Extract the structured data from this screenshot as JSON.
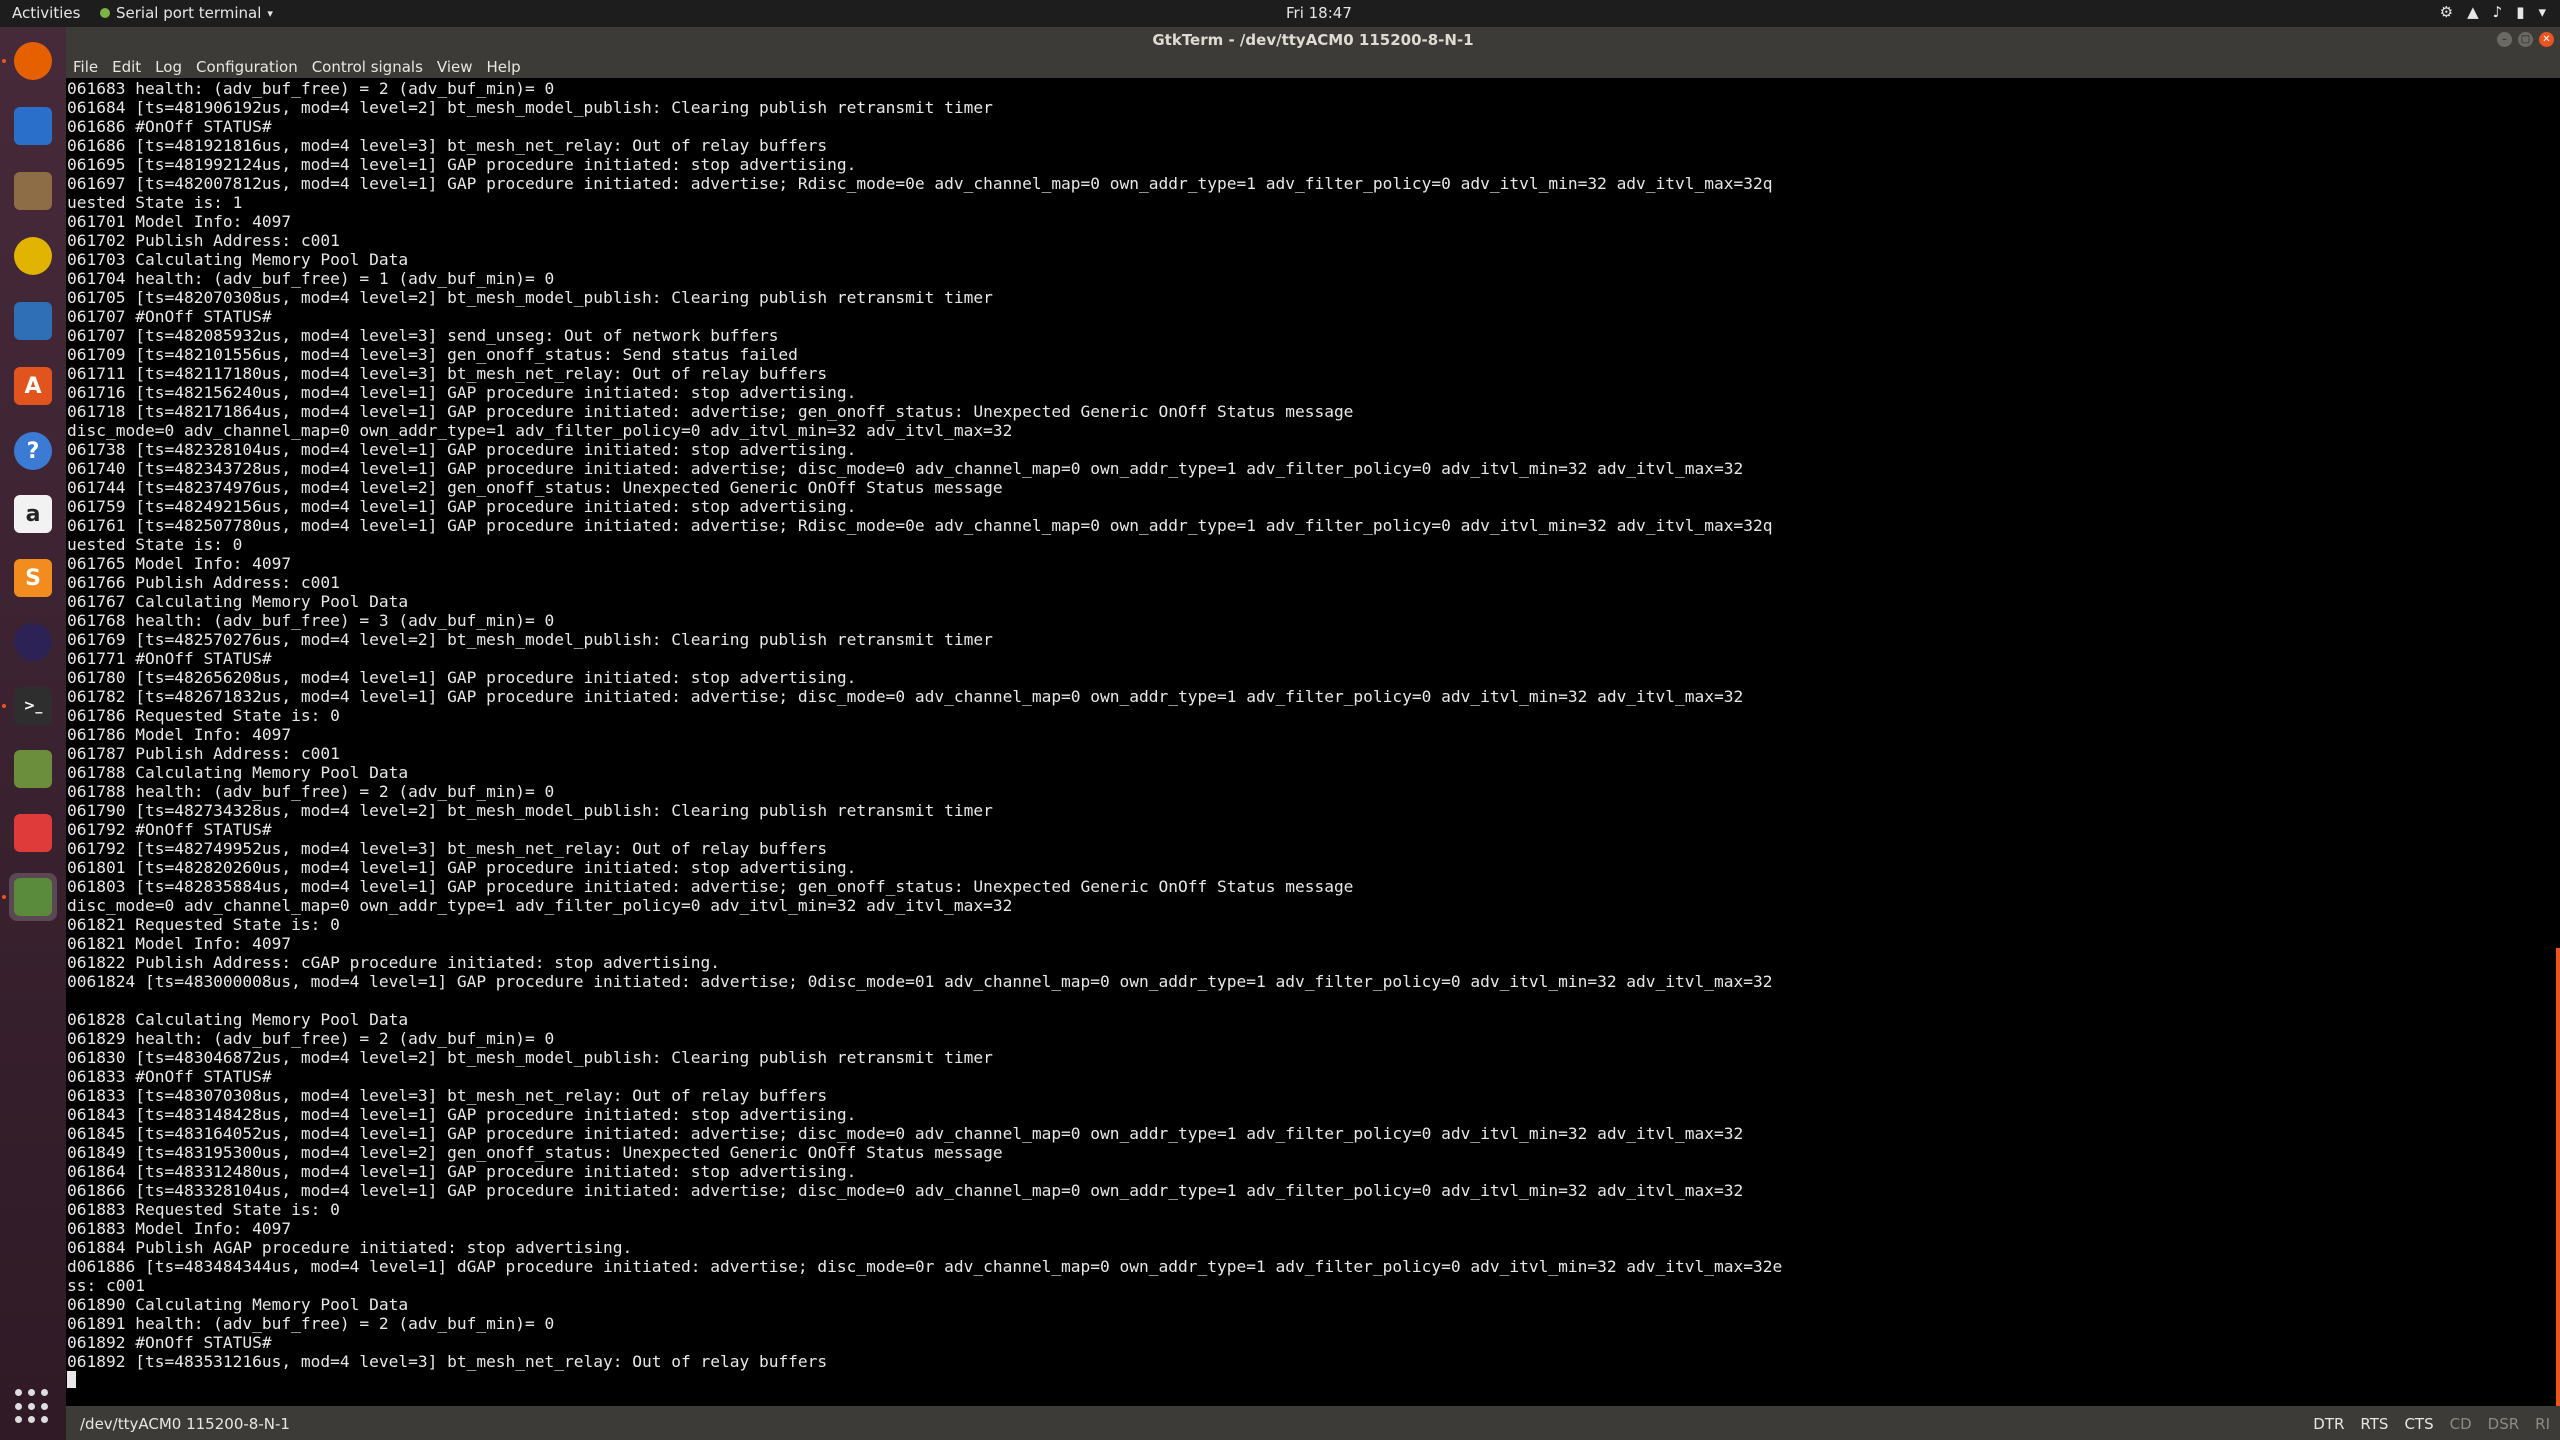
{
  "topbar": {
    "activities": "Activities",
    "app_name": "Serial port terminal",
    "clock": "Fri 18:47"
  },
  "window": {
    "title": "GtkTerm - /dev/ttyACM0  115200-8-N-1"
  },
  "menu": [
    "File",
    "Edit",
    "Log",
    "Configuration",
    "Control signals",
    "View",
    "Help"
  ],
  "dock": [
    {
      "name": "firefox-icon",
      "glyph": "",
      "color": "#e66000"
    },
    {
      "name": "thunderbird-icon",
      "glyph": "",
      "color": "#2a6fc9"
    },
    {
      "name": "files-icon",
      "glyph": "",
      "color": "#8c6d46"
    },
    {
      "name": "rhythmbox-icon",
      "glyph": "",
      "color": "#e0b400"
    },
    {
      "name": "writer-icon",
      "glyph": "",
      "color": "#2f6fb5"
    },
    {
      "name": "software-center-icon",
      "glyph": "A",
      "color": "#e2541d"
    },
    {
      "name": "help-icon",
      "glyph": "?",
      "color": "#3b7bd4"
    },
    {
      "name": "amazon-icon",
      "glyph": "a",
      "color": "#f2f2f2"
    },
    {
      "name": "sublime-text-icon",
      "glyph": "S",
      "color": "#f28c1e"
    },
    {
      "name": "eclipse-icon",
      "glyph": "",
      "color": "#2c2255"
    },
    {
      "name": "terminal-icon",
      "glyph": ">_",
      "color": "#2e2e2e"
    },
    {
      "name": "image-viewer-icon",
      "glyph": "",
      "color": "#6a8e3c"
    },
    {
      "name": "pdf-viewer-icon",
      "glyph": "",
      "color": "#e03b3b"
    },
    {
      "name": "serial-terminal-icon",
      "glyph": "",
      "color": "#5a8a3c"
    }
  ],
  "terminal": {
    "lines": [
      "061683 health: (adv_buf_free) = 2 (adv_buf_min)= 0",
      "061684 [ts=481906192us, mod=4 level=2] bt_mesh_model_publish: Clearing publish retransmit timer",
      "061686 #OnOff STATUS#",
      "061686 [ts=481921816us, mod=4 level=3] bt_mesh_net_relay: Out of relay buffers",
      "061695 [ts=481992124us, mod=4 level=1] GAP procedure initiated: stop advertising.",
      "061697 [ts=482007812us, mod=4 level=1] GAP procedure initiated: advertise; Rdisc_mode=0e adv_channel_map=0 own_addr_type=1 adv_filter_policy=0 adv_itvl_min=32 adv_itvl_max=32q",
      "uested State is: 1",
      "061701 Model Info: 4097",
      "061702 Publish Address: c001",
      "061703 Calculating Memory Pool Data",
      "061704 health: (adv_buf_free) = 1 (adv_buf_min)= 0",
      "061705 [ts=482070308us, mod=4 level=2] bt_mesh_model_publish: Clearing publish retransmit timer",
      "061707 #OnOff STATUS#",
      "061707 [ts=482085932us, mod=4 level=3] send_unseg: Out of network buffers",
      "061709 [ts=482101556us, mod=4 level=3] gen_onoff_status: Send status failed",
      "061711 [ts=482117180us, mod=4 level=3] bt_mesh_net_relay: Out of relay buffers",
      "061716 [ts=482156240us, mod=4 level=1] GAP procedure initiated: stop advertising.",
      "061718 [ts=482171864us, mod=4 level=1] GAP procedure initiated: advertise; gen_onoff_status: Unexpected Generic OnOff Status message",
      "disc_mode=0 adv_channel_map=0 own_addr_type=1 adv_filter_policy=0 adv_itvl_min=32 adv_itvl_max=32",
      "061738 [ts=482328104us, mod=4 level=1] GAP procedure initiated: stop advertising.",
      "061740 [ts=482343728us, mod=4 level=1] GAP procedure initiated: advertise; disc_mode=0 adv_channel_map=0 own_addr_type=1 adv_filter_policy=0 adv_itvl_min=32 adv_itvl_max=32",
      "061744 [ts=482374976us, mod=4 level=2] gen_onoff_status: Unexpected Generic OnOff Status message",
      "061759 [ts=482492156us, mod=4 level=1] GAP procedure initiated: stop advertising.",
      "061761 [ts=482507780us, mod=4 level=1] GAP procedure initiated: advertise; Rdisc_mode=0e adv_channel_map=0 own_addr_type=1 adv_filter_policy=0 adv_itvl_min=32 adv_itvl_max=32q",
      "uested State is: 0",
      "061765 Model Info: 4097",
      "061766 Publish Address: c001",
      "061767 Calculating Memory Pool Data",
      "061768 health: (adv_buf_free) = 3 (adv_buf_min)= 0",
      "061769 [ts=482570276us, mod=4 level=2] bt_mesh_model_publish: Clearing publish retransmit timer",
      "061771 #OnOff STATUS#",
      "061780 [ts=482656208us, mod=4 level=1] GAP procedure initiated: stop advertising.",
      "061782 [ts=482671832us, mod=4 level=1] GAP procedure initiated: advertise; disc_mode=0 adv_channel_map=0 own_addr_type=1 adv_filter_policy=0 adv_itvl_min=32 adv_itvl_max=32",
      "061786 Requested State is: 0",
      "061786 Model Info: 4097",
      "061787 Publish Address: c001",
      "061788 Calculating Memory Pool Data",
      "061788 health: (adv_buf_free) = 2 (adv_buf_min)= 0",
      "061790 [ts=482734328us, mod=4 level=2] bt_mesh_model_publish: Clearing publish retransmit timer",
      "061792 #OnOff STATUS#",
      "061792 [ts=482749952us, mod=4 level=3] bt_mesh_net_relay: Out of relay buffers",
      "061801 [ts=482820260us, mod=4 level=1] GAP procedure initiated: stop advertising.",
      "061803 [ts=482835884us, mod=4 level=1] GAP procedure initiated: advertise; gen_onoff_status: Unexpected Generic OnOff Status message",
      "disc_mode=0 adv_channel_map=0 own_addr_type=1 adv_filter_policy=0 adv_itvl_min=32 adv_itvl_max=32",
      "061821 Requested State is: 0",
      "061821 Model Info: 4097",
      "061822 Publish Address: cGAP procedure initiated: stop advertising.",
      "0061824 [ts=483000008us, mod=4 level=1] GAP procedure initiated: advertise; 0disc_mode=01 adv_channel_map=0 own_addr_type=1 adv_filter_policy=0 adv_itvl_min=32 adv_itvl_max=32",
      "",
      "061828 Calculating Memory Pool Data",
      "061829 health: (adv_buf_free) = 2 (adv_buf_min)= 0",
      "061830 [ts=483046872us, mod=4 level=2] bt_mesh_model_publish: Clearing publish retransmit timer",
      "061833 #OnOff STATUS#",
      "061833 [ts=483070308us, mod=4 level=3] bt_mesh_net_relay: Out of relay buffers",
      "061843 [ts=483148428us, mod=4 level=1] GAP procedure initiated: stop advertising.",
      "061845 [ts=483164052us, mod=4 level=1] GAP procedure initiated: advertise; disc_mode=0 adv_channel_map=0 own_addr_type=1 adv_filter_policy=0 adv_itvl_min=32 adv_itvl_max=32",
      "061849 [ts=483195300us, mod=4 level=2] gen_onoff_status: Unexpected Generic OnOff Status message",
      "061864 [ts=483312480us, mod=4 level=1] GAP procedure initiated: stop advertising.",
      "061866 [ts=483328104us, mod=4 level=1] GAP procedure initiated: advertise; disc_mode=0 adv_channel_map=0 own_addr_type=1 adv_filter_policy=0 adv_itvl_min=32 adv_itvl_max=32",
      "061883 Requested State is: 0",
      "061883 Model Info: 4097",
      "061884 Publish AGAP procedure initiated: stop advertising.",
      "d061886 [ts=483484344us, mod=4 level=1] dGAP procedure initiated: advertise; disc_mode=0r adv_channel_map=0 own_addr_type=1 adv_filter_policy=0 adv_itvl_min=32 adv_itvl_max=32e",
      "ss: c001",
      "061890 Calculating Memory Pool Data",
      "061891 health: (adv_buf_free) = 2 (adv_buf_min)= 0",
      "061892 #OnOff STATUS#",
      "061892 [ts=483531216us, mod=4 level=3] bt_mesh_net_relay: Out of relay buffers"
    ]
  },
  "statusbar": {
    "port": "/dev/ttyACM0  115200-8-N-1",
    "signals": [
      {
        "label": "DTR",
        "active": true
      },
      {
        "label": "RTS",
        "active": true
      },
      {
        "label": "CTS",
        "active": true
      },
      {
        "label": "CD",
        "active": false
      },
      {
        "label": "DSR",
        "active": false
      },
      {
        "label": "RI",
        "active": false
      }
    ]
  },
  "colors": {
    "accent": "#e95420",
    "terminal_bg": "#000000",
    "terminal_fg": "#e8e8e8"
  }
}
